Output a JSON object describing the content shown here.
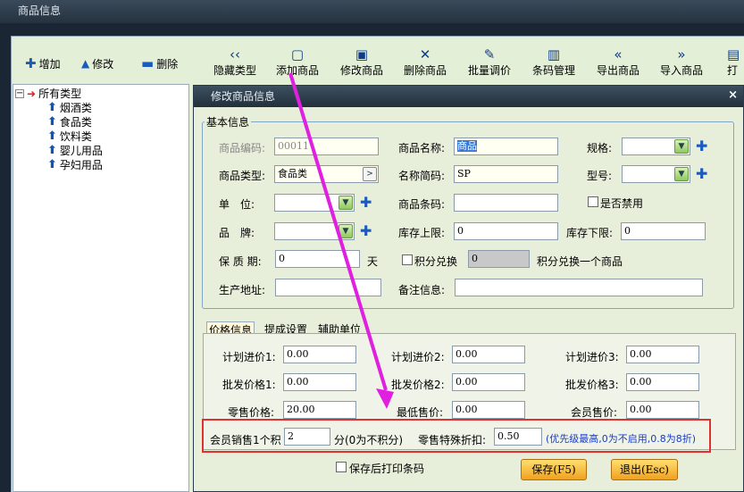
{
  "window": {
    "title": "商品信息"
  },
  "left_toolbar": {
    "add": "增加",
    "edit": "修改",
    "delete": "删除"
  },
  "toolbar": [
    {
      "label": "隐藏类型",
      "icon": "‹‹"
    },
    {
      "label": "添加商品",
      "icon": "▢"
    },
    {
      "label": "修改商品",
      "icon": "▣"
    },
    {
      "label": "删除商品",
      "icon": "✕"
    },
    {
      "label": "批量调价",
      "icon": "✎"
    },
    {
      "label": "条码管理",
      "icon": "▥"
    },
    {
      "label": "导出商品",
      "icon": "«"
    },
    {
      "label": "导入商品",
      "icon": "»"
    },
    {
      "label": "打",
      "icon": "▤"
    }
  ],
  "tree": {
    "root": "所有类型",
    "children": [
      "烟酒类",
      "食品类",
      "饮料类",
      "婴儿用品",
      "孕妇用品"
    ]
  },
  "dialog": {
    "title": "修改商品信息",
    "close": "×",
    "basic": {
      "legend": "基本信息",
      "code_label": "商品编码:",
      "code_value": "00011",
      "name_label": "商品名称:",
      "name_value": "商品",
      "spec_label": "规格:",
      "type_label": "商品类型:",
      "type_value": "食品类",
      "abbr_label": "名称简码:",
      "abbr_value": "SP",
      "model_label": "型号:",
      "unit_label": "单　位:",
      "barcode_label": "商品条码:",
      "disabled_label": "是否禁用",
      "brand_label": "品　牌:",
      "stock_upper_label": "库存上限:",
      "stock_upper_value": "0",
      "stock_lower_label": "库存下限:",
      "stock_lower_value": "0",
      "shelf_label": "保 质 期:",
      "shelf_value": "0",
      "shelf_unit": "天",
      "points_label": "积分兑换",
      "points_value": "0",
      "points_suffix": "积分兑换一个商品",
      "origin_label": "生产地址:",
      "remark_label": "备注信息:"
    },
    "tabs": [
      "价格信息",
      "提成设置",
      "辅助单位"
    ],
    "price": {
      "plan1_label": "计划进价1:",
      "plan1": "0.00",
      "plan2_label": "计划进价2:",
      "plan2": "0.00",
      "plan3_label": "计划进价3:",
      "plan3": "0.00",
      "whole1_label": "批发价格1:",
      "whole1": "0.00",
      "whole2_label": "批发价格2:",
      "whole2": "0.00",
      "whole3_label": "批发价格3:",
      "whole3": "0.00",
      "retail_label": "零售价格:",
      "retail": "20.00",
      "min_label": "最低售价:",
      "min": "0.00",
      "member_label": "会员售价:",
      "member": "0.00"
    },
    "member_points": {
      "prefix": "会员销售1个积",
      "value": "2",
      "suffix": "分(0为不积分)"
    },
    "discount": {
      "label": "零售特殊折扣:",
      "value": "0.50",
      "hint": "(优先级最高,0为不启用,0.8为8折)"
    },
    "print_label": "保存后打印条码",
    "save": "保存(F5)",
    "exit": "退出(Esc)"
  },
  "colors": {
    "accent_arrow": "#e020e0",
    "highlight_box": "#e03030",
    "hint_text": "#1a3cc8"
  }
}
